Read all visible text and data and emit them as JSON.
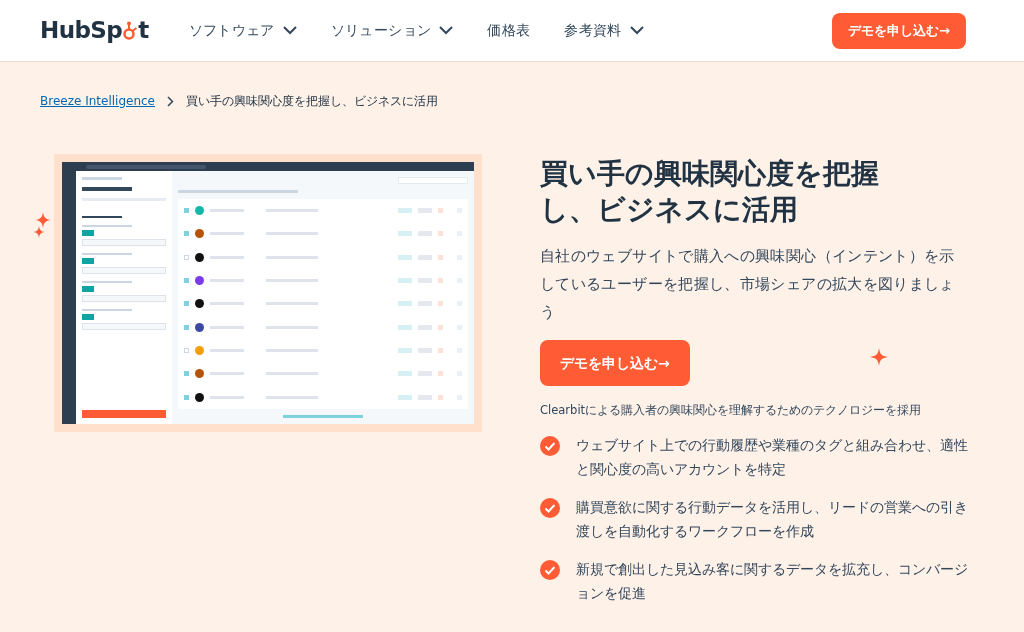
{
  "header": {
    "logo_parts": [
      "HubSp",
      "t"
    ],
    "nav": [
      {
        "label": "ソフトウェア",
        "dropdown": true
      },
      {
        "label": "ソリューション",
        "dropdown": true
      },
      {
        "label": "価格表",
        "dropdown": false
      },
      {
        "label": "参考資料",
        "dropdown": true
      }
    ],
    "cta": "デモを申し込む→"
  },
  "breadcrumb": {
    "link": "Breeze Intelligence",
    "current": "買い手の興味関心度を把握し、ビジネスに活用"
  },
  "hero": {
    "title": "買い手の興味関心度を把握し、ビジネスに活用",
    "description": "自社のウェブサイトで購入への興味関心（インテント）を示しているユーザーを把握し、市場シェアの拡大を図りましょう",
    "cta": "デモを申し込む→",
    "caption": "Clearbitによる購入者の興味関心を理解するためのテクノロジーを採用",
    "features": [
      "ウェブサイト上での行動履歴や業種のタグと組み合わせ、適性と関心度の高いアカウントを特定",
      "購買意欲に関する行動データを活用し、リードの営業への引き渡しを自動化するワークフローを作成",
      "新規で創出した見込み客に関するデータを拡充し、コンバージョンを促進"
    ]
  }
}
